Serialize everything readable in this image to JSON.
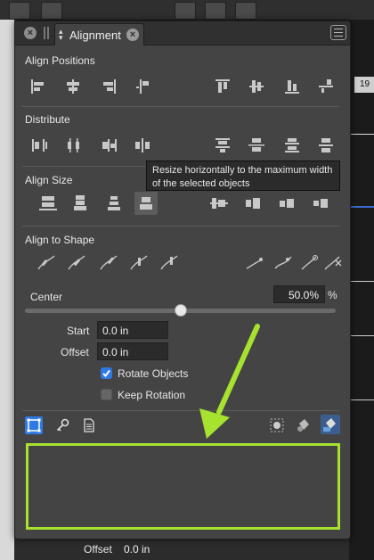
{
  "panel": {
    "tab_title": "Alignment",
    "sections": {
      "align_positions": "Align Positions",
      "distribute": "Distribute",
      "align_size": "Align Size",
      "align_to_shape": "Align to Shape"
    },
    "tooltip": "Resize horizontally to the maximum width of the selected objects",
    "center": {
      "label": "Center",
      "value": "50.0%",
      "unit": "%",
      "slider_fraction": 0.5
    },
    "start": {
      "label": "Start",
      "value": "0.0 in"
    },
    "offset": {
      "label": "Offset",
      "value": "0.0 in"
    },
    "rotate_objects": {
      "label": "Rotate Objects",
      "checked": true
    },
    "keep_rotation": {
      "label": "Keep Rotation",
      "checked": false
    }
  },
  "background": {
    "ruler_number": "19",
    "offset_label": "Offset",
    "offset_value": "0.0 in"
  },
  "colors": {
    "accent": "#2f7ae5",
    "highlight": "#a6e22e",
    "panel_bg": "#444444"
  },
  "icons": [
    "close-icon",
    "drag-handle-icon",
    "chevron-updown-icon",
    "panel-menu-icon",
    "key-icon",
    "document-icon",
    "selection-box-icon"
  ]
}
